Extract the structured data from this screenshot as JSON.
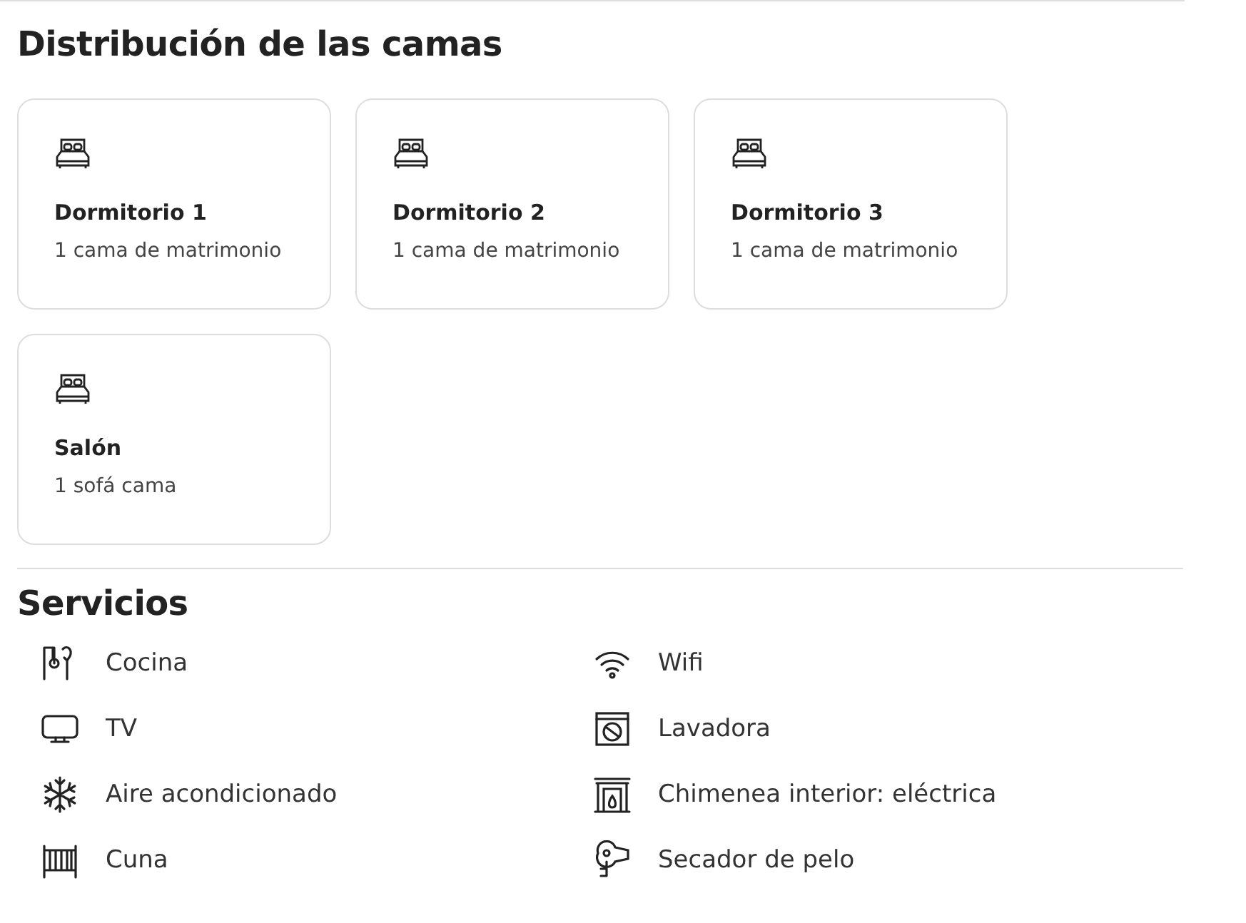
{
  "sleeping": {
    "title": "Distribución de las camas",
    "rooms": [
      {
        "name": "Dormitorio 1",
        "beds": "1 cama de matrimonio"
      },
      {
        "name": "Dormitorio 2",
        "beds": "1 cama de matrimonio"
      },
      {
        "name": "Dormitorio 3",
        "beds": "1 cama de matrimonio"
      },
      {
        "name": "Salón",
        "beds": "1 sofá cama"
      }
    ]
  },
  "amenities": {
    "title": "Servicios",
    "items": [
      {
        "label": "Cocina",
        "kind": "kitchen"
      },
      {
        "label": "Wifi",
        "kind": "wifi"
      },
      {
        "label": "TV",
        "kind": "tv"
      },
      {
        "label": "Lavadora",
        "kind": "washer"
      },
      {
        "label": "Aire acondicionado",
        "kind": "ac"
      },
      {
        "label": "Chimenea interior: eléctrica",
        "kind": "fireplace"
      },
      {
        "label": "Cuna",
        "kind": "crib"
      },
      {
        "label": "Secador de pelo",
        "kind": "hairdryer"
      }
    ]
  }
}
